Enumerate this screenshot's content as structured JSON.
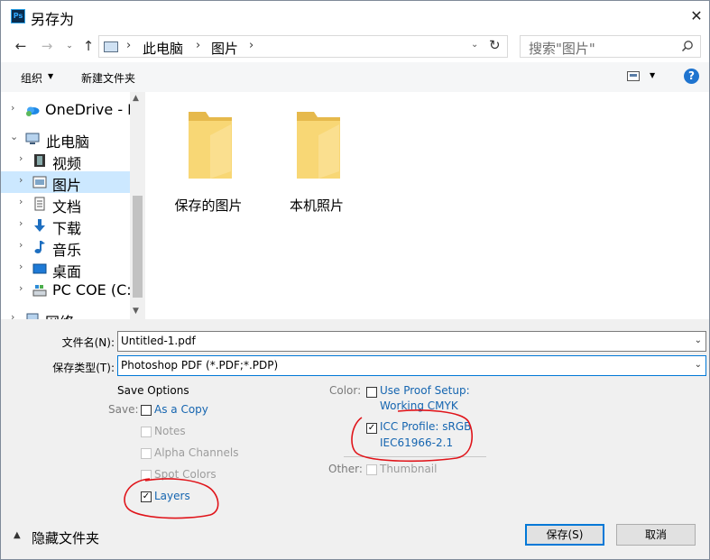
{
  "window": {
    "app_icon_text": "Ps",
    "title": "另存为"
  },
  "address_bar": {
    "crumbs": [
      "此电脑",
      "图片"
    ],
    "search_placeholder": "搜索\"图片\""
  },
  "toolbar": {
    "organize_label": "组织",
    "new_folder_label": "新建文件夹"
  },
  "nav_tree": [
    {
      "label": "OneDrive - F",
      "icon": "onedrive-icon",
      "chevron": "›"
    },
    {
      "label": "此电脑",
      "icon": "pc-icon",
      "chevron": "⌄"
    },
    {
      "label": "视频",
      "icon": "video-icon",
      "chevron": "›"
    },
    {
      "label": "图片",
      "icon": "pictures-icon",
      "chevron": "›",
      "selected": true
    },
    {
      "label": "文档",
      "icon": "document-icon",
      "chevron": "›"
    },
    {
      "label": "下载",
      "icon": "download-icon",
      "chevron": "›"
    },
    {
      "label": "音乐",
      "icon": "music-icon",
      "chevron": "›"
    },
    {
      "label": "桌面",
      "icon": "desktop-icon",
      "chevron": "›"
    },
    {
      "label": "PC COE (C:)",
      "icon": "drive-icon",
      "chevron": "›"
    },
    {
      "label": "网络",
      "icon": "network-icon",
      "chevron": "›"
    }
  ],
  "folders": [
    {
      "label": "保存的图片"
    },
    {
      "label": "本机照片"
    }
  ],
  "form": {
    "filename_label": "文件名(N):",
    "filename_value": "Untitled-1.pdf",
    "filetype_label": "保存类型(T):",
    "filetype_value": "Photoshop PDF (*.PDF;*.PDP)"
  },
  "save_options": {
    "heading": "Save Options",
    "save_label": "Save:",
    "as_a_copy": {
      "label": "As a Copy",
      "checked": false
    },
    "notes": {
      "label": "Notes",
      "checked": false,
      "enabled": false
    },
    "alpha_channels": {
      "label": "Alpha Channels",
      "checked": false,
      "enabled": false
    },
    "spot_colors": {
      "label": "Spot Colors",
      "checked": false,
      "enabled": false
    },
    "layers": {
      "label": "Layers",
      "checked": true
    },
    "color_label": "Color:",
    "use_proof_setup": {
      "label_line1": "Use Proof Setup:",
      "label_line2": "Working CMYK",
      "checked": false
    },
    "icc_profile": {
      "label_line1": "ICC Profile:  sRGB",
      "label_line2": "IEC61966-2.1",
      "checked": true
    },
    "other_label": "Other:",
    "thumbnail": {
      "label": "Thumbnail",
      "checked": false,
      "enabled": false
    }
  },
  "bottom": {
    "hide_folders_label": "隐藏文件夹",
    "save_button": "保存(S)",
    "cancel_button": "取消"
  },
  "colors": {
    "accent": "#0078d7",
    "link_blue": "#1565b0",
    "annotation_red": "#e0141a",
    "folder_yellow": "#f8d775",
    "selected_bg": "#cce8ff"
  }
}
